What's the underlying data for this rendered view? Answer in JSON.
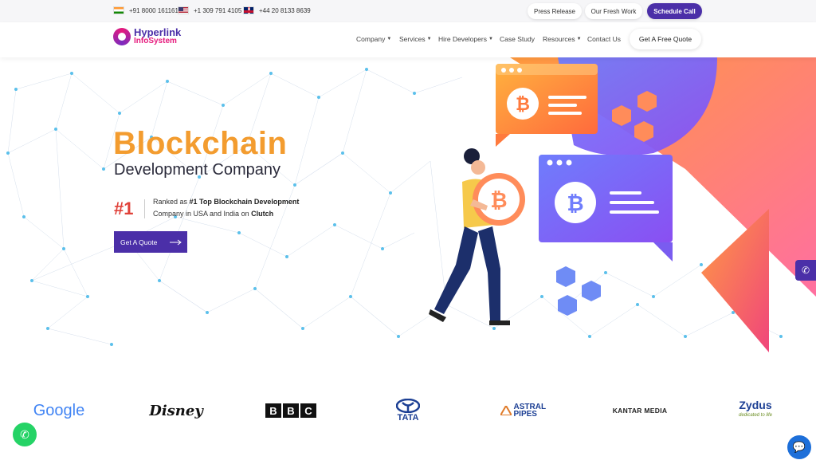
{
  "topbar": {
    "phones": [
      {
        "flag": "india-flag-icon",
        "number": "+91 8000 161161"
      },
      {
        "flag": "usa-flag-icon",
        "number": "+1 309 791 4105"
      },
      {
        "flag": "uk-flag-icon",
        "number": "+44 20 8133 8639"
      }
    ],
    "press_release": "Press Release",
    "fresh_work": "Our Fresh Work",
    "schedule_call": "Schedule Call"
  },
  "header": {
    "logo_line1": "Hyperlink",
    "logo_line2": "InfoSystem",
    "nav": [
      {
        "label": "Company",
        "dropdown": true
      },
      {
        "label": "Services",
        "dropdown": true
      },
      {
        "label": "Hire Developers",
        "dropdown": true
      },
      {
        "label": "Case Study",
        "dropdown": false
      },
      {
        "label": "Resources",
        "dropdown": true
      },
      {
        "label": "Contact Us",
        "dropdown": false
      }
    ],
    "quote_button": "Get A Free Quote"
  },
  "hero": {
    "title": "Blockchain",
    "subtitle": "Development Company",
    "rank_badge": "#1",
    "rank_prefix": "Ranked as ",
    "rank_bold": "#1 Top Blockchain Development",
    "rank_middle": "Company in USA and India on ",
    "rank_source": "Clutch",
    "cta": "Get A Quote"
  },
  "clients": [
    {
      "name": "Google",
      "icon": "google-logo"
    },
    {
      "name": "Disney",
      "icon": "disney-logo"
    },
    {
      "name": "BBC",
      "icon": "bbc-logo"
    },
    {
      "name": "TATA",
      "icon": "tata-logo"
    },
    {
      "name": "ASTRAL PIPES",
      "icon": "astral-logo"
    },
    {
      "name": "KANTAR MEDIA",
      "icon": "kantar-logo"
    },
    {
      "name": "Zydus",
      "tagline": "dedicated to life",
      "icon": "zydus-logo"
    }
  ],
  "colors": {
    "brand_purple": "#4b2fa8",
    "accent_orange": "#f39c2f",
    "rank_red": "#e0423a"
  }
}
